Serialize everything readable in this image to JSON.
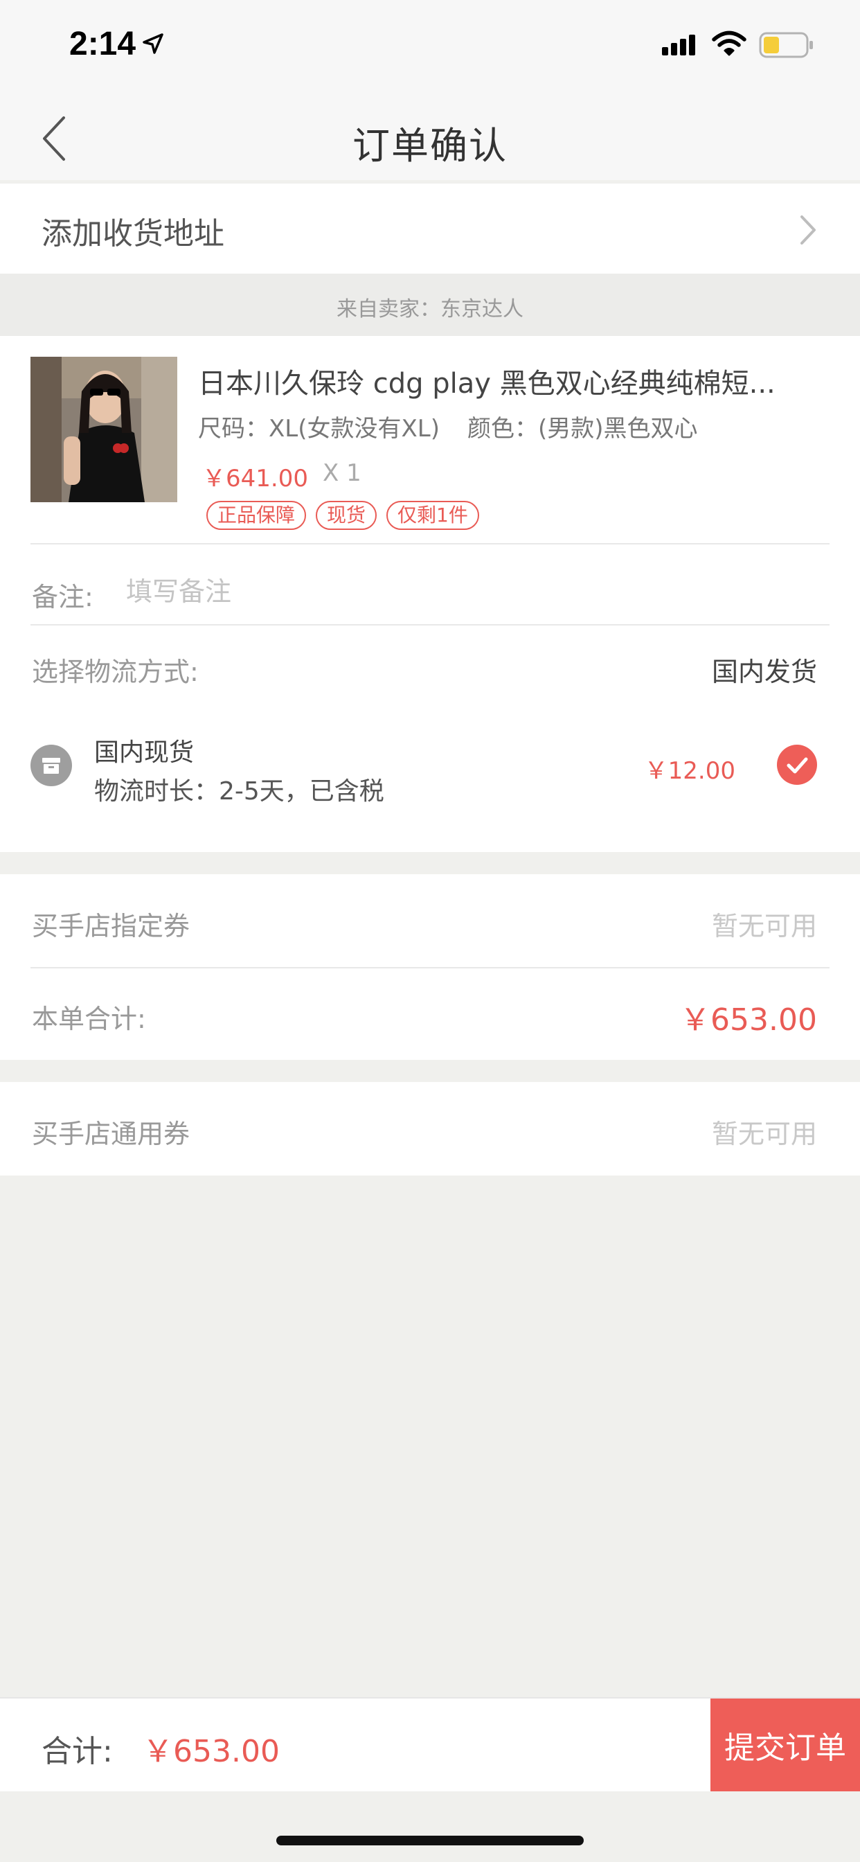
{
  "status_bar": {
    "time": "2:14",
    "icons": [
      "location-arrow-icon",
      "cellular-signal-icon",
      "wifi-icon",
      "battery-icon"
    ],
    "battery_color": "#f5cd3a"
  },
  "nav": {
    "title": "订单确认",
    "back_icon": "chevron-left-icon"
  },
  "address": {
    "label": "添加收货地址",
    "chevron_icon": "chevron-right-icon"
  },
  "seller": {
    "text": "来自卖家：东京达人"
  },
  "product": {
    "title": "日本川久保玲 cdg play 黑色双心经典纯棉短...",
    "size": "尺码：XL(女款没有XL)",
    "color": "颜色：(男款)黑色双心",
    "price": "￥641.00",
    "quantity": "X 1",
    "tags": [
      "正品保障",
      "现货",
      "仅剩1件"
    ]
  },
  "remark": {
    "label": "备注:",
    "placeholder": "填写备注",
    "value": ""
  },
  "shipping": {
    "label": "选择物流方式:",
    "selected": "国内发货",
    "option": {
      "name": "国内现货",
      "duration": "物流时长：2-5天，已含税",
      "price": "￥12.00",
      "icon": "package-box-icon",
      "checked": true
    }
  },
  "coupons": {
    "store_specific": {
      "label": "买手店指定券",
      "value": "暂无可用"
    },
    "subtotal": {
      "label": "本单合计:",
      "value": "￥653.00"
    },
    "store_general": {
      "label": "买手店通用券",
      "value": "暂无可用"
    }
  },
  "footer": {
    "total_label": "合计:",
    "total_value": "￥653.00",
    "submit_label": "提交订单"
  },
  "colors": {
    "accent": "#ee5e58",
    "page_background": "#f0f0ed"
  }
}
